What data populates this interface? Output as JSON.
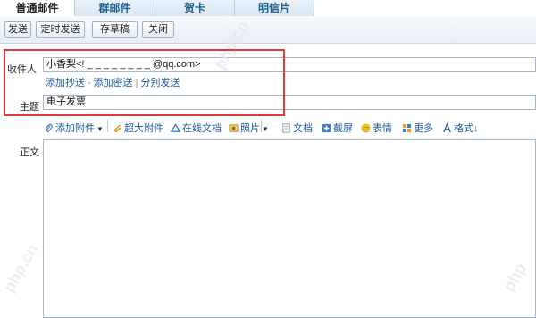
{
  "tabs": [
    {
      "label": "普通邮件",
      "active": true
    },
    {
      "label": "群邮件",
      "active": false
    },
    {
      "label": "贺卡",
      "active": false
    },
    {
      "label": "明信片",
      "active": false
    }
  ],
  "toolbar": {
    "send": "发送",
    "scheduled_send": "定时发送",
    "save_draft": "存草稿",
    "close": "关闭"
  },
  "recipient": {
    "label": "收件人",
    "value": "小香梨<! _ _ _ _ _ _ _ _ @qq.com>"
  },
  "recipient_links": {
    "add_cc": "添加抄送",
    "add_bcc": "添加密送",
    "separate_send": "分别发送"
  },
  "subject": {
    "label": "主题",
    "value": "电子发票"
  },
  "attach_toolbar": {
    "attachment": "添加附件",
    "large_attachment": "超大附件",
    "online_doc": "在线文档",
    "photo": "照片",
    "document": "文档",
    "screenshot": "截屏",
    "emoji": "表情",
    "more": "更多",
    "format": "格式"
  },
  "body": {
    "label": "正文"
  },
  "colors": {
    "accent_link": "#1e5a9e",
    "highlight_box": "#e0393e"
  }
}
